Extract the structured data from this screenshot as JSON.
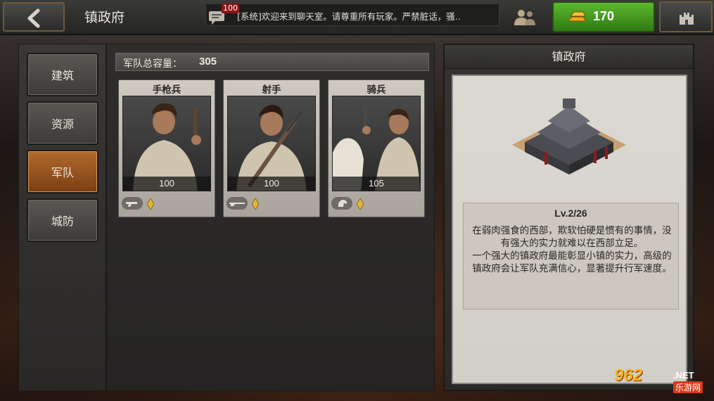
{
  "topbar": {
    "title": "镇政府",
    "chat_count": "100",
    "chat_message": "[系统]欢迎来到聊天室。请尊重所有玩家。严禁脏话，骚..",
    "gold_amount": "170"
  },
  "sidebar": {
    "items": [
      {
        "label": "建筑"
      },
      {
        "label": "资源"
      },
      {
        "label": "军队",
        "active": true
      },
      {
        "label": "城防"
      }
    ]
  },
  "army": {
    "capacity_label": "军队总容量：",
    "capacity_value": "305",
    "units": [
      {
        "name": "手枪兵",
        "power": "100",
        "weapon": "pistol-icon"
      },
      {
        "name": "射手",
        "power": "100",
        "weapon": "rifle-icon"
      },
      {
        "name": "骑兵",
        "power": "105",
        "weapon": "horse-icon"
      }
    ]
  },
  "info": {
    "title": "镇政府",
    "level": "Lv.2/26",
    "description": "在弱肉强食的西部，欺软怕硬是惯有的事情，没有强大的实力就难以在西部立足。\n一个强大的镇政府最能彰显小镇的实力，高级的镇政府会让军队充满信心，显著提升行军速度。"
  },
  "watermark": {
    "logo": "962",
    "net": ".NET",
    "sub": "乐游网"
  },
  "colors": {
    "gold_button": "#3f9a1e",
    "active_tab": "#9a5520",
    "card_bg": "#c4c0b8"
  }
}
